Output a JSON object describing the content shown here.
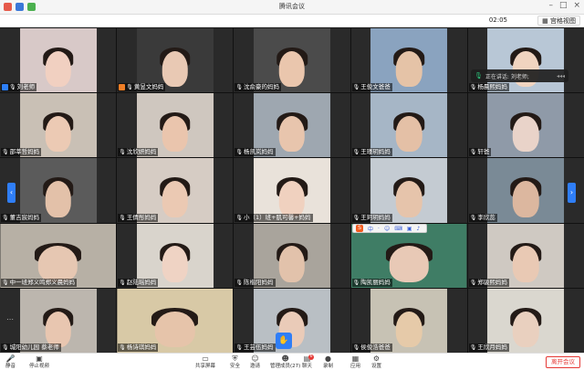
{
  "window": {
    "title": "腾讯会议"
  },
  "infobar": {
    "timer": "02:05",
    "view_label": "宫格视图"
  },
  "speaking": {
    "text": "正在讲话: 刘老师;"
  },
  "colors": {
    "accent": "#2f7ef7",
    "leave": "#e53935",
    "mic_on": "#19b04f",
    "host_badge": "#2d7ff9",
    "cohost_badge": "#f07e26"
  },
  "grid": {
    "tiles": [
      {
        "name": "刘老师",
        "role": "host"
      },
      {
        "name": "黄昱文妈妈",
        "role": "cohost"
      },
      {
        "name": "沈俞豪的妈妈"
      },
      {
        "name": "王俊文爸爸"
      },
      {
        "name": "杨晨熙妈妈"
      },
      {
        "name": "邵莘哲妈妈"
      },
      {
        "name": "沈欣妍妈妈"
      },
      {
        "name": "杨凯岚妈妈"
      },
      {
        "name": "王瑾玥妈妈"
      },
      {
        "name": "轩爸"
      },
      {
        "name": "董吉宸妈妈"
      },
      {
        "name": "王倩彤妈妈"
      },
      {
        "name": "小（1）班+肌可馨+妈妈"
      },
      {
        "name": "王珂玥妈妈"
      },
      {
        "name": "李欣蕊"
      },
      {
        "name": "中一班郑义鸣郑义晨妈妈"
      },
      {
        "name": "赵陆瑶妈妈"
      },
      {
        "name": "陈楷阳妈妈"
      },
      {
        "name": "陶凯丽妈妈"
      },
      {
        "name": "郑骏熙妈妈"
      },
      {
        "name": "城阳幼儿园  蔡老师"
      },
      {
        "name": "杨诗琪妈妈"
      },
      {
        "name": "王芸伍妈妈"
      },
      {
        "name": "侯俊浩爸爸"
      },
      {
        "name": "王欣月妈妈"
      }
    ]
  },
  "toolbar": {
    "mute": "静音",
    "video": "停止视频",
    "share": "共享屏幕",
    "security": "安全",
    "invite": "邀请",
    "members": "管理成员(27)",
    "chat": "聊天",
    "chat_badge": "6",
    "record": "录制",
    "apps": "应用",
    "settings": "设置",
    "leave": "离开会议"
  },
  "sogou": {
    "items": [
      "S",
      "中",
      "·",
      "☺",
      "⌨",
      "▣",
      "♪"
    ]
  }
}
